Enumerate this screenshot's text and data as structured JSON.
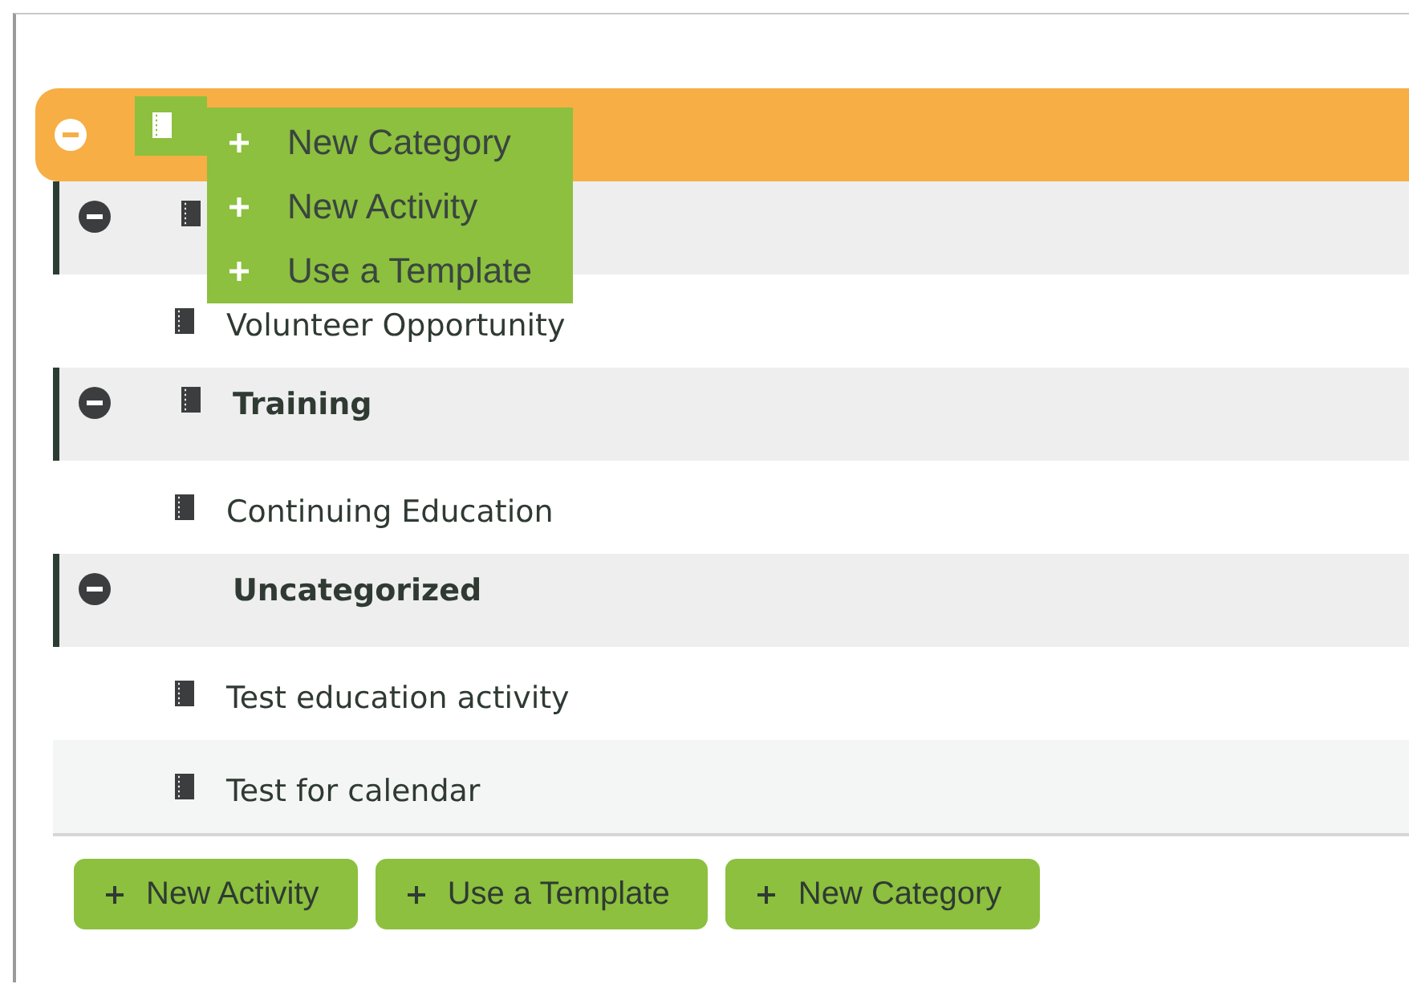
{
  "tree": [
    {
      "kind": "category",
      "selected": true,
      "expanded": true,
      "icon": true
    },
    {
      "kind": "category",
      "selected": false,
      "expanded": true,
      "icon": true
    },
    {
      "kind": "activity",
      "selected": false,
      "icon": true,
      "label": "Volunteer Opportunity"
    },
    {
      "kind": "category",
      "selected": false,
      "expanded": true,
      "icon": true,
      "label": "Training"
    },
    {
      "kind": "activity",
      "selected": false,
      "icon": true,
      "label": "Continuing Education"
    },
    {
      "kind": "category",
      "selected": false,
      "expanded": true,
      "icon": false,
      "label": "Uncategorized"
    },
    {
      "kind": "activity",
      "selected": false,
      "icon": true,
      "label": "Test education activity"
    },
    {
      "kind": "activity",
      "selected": false,
      "icon": true,
      "label": "Test for calendar"
    }
  ],
  "menu": {
    "items": [
      "New Category",
      "New Activity",
      "Use a Template"
    ]
  },
  "buttons": [
    "New Activity",
    "Use a Template",
    "New Category"
  ]
}
